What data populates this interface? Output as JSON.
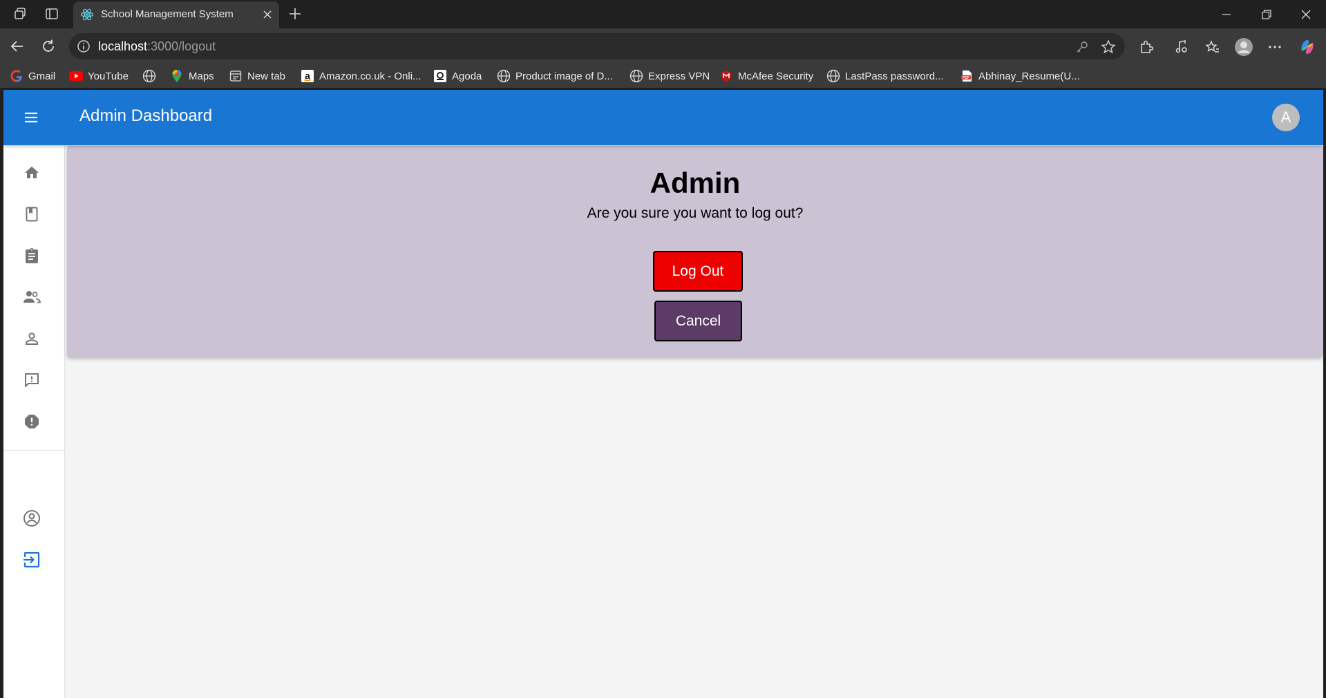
{
  "browser": {
    "tab_title": "School Management System",
    "url_host": "localhost",
    "url_rest": ":3000/logout",
    "bookmarks": [
      {
        "label": "Gmail",
        "icon": "google-icon"
      },
      {
        "label": "YouTube",
        "icon": "youtube-icon"
      },
      {
        "label": "",
        "icon": "globe-icon"
      },
      {
        "label": "Maps",
        "icon": "maps-icon"
      },
      {
        "label": "New tab",
        "icon": "newtab-icon"
      },
      {
        "label": "Amazon.co.uk - Onli...",
        "icon": "amazon-icon"
      },
      {
        "label": "Agoda",
        "icon": "agoda-icon"
      },
      {
        "label": "Product image of D...",
        "icon": "globe-icon"
      },
      {
        "label": "Express VPN",
        "icon": "globe-icon"
      },
      {
        "label": "McAfee Security",
        "icon": "mcafee-icon"
      },
      {
        "label": "LastPass password...",
        "icon": "globe-icon"
      },
      {
        "label": "Abhinay_Resume(U...",
        "icon": "pdf-icon"
      }
    ]
  },
  "app": {
    "title": "Admin Dashboard",
    "avatar_letter": "A",
    "accent_color": "#1976d2",
    "sidebar_icons": [
      "home-icon",
      "class-icon",
      "assignment-icon",
      "teachers-icon",
      "student-icon",
      "notice-icon",
      "complaint-icon",
      "profile-icon",
      "logout-icon"
    ]
  },
  "logout": {
    "heading": "Admin",
    "message": "Are you sure you want to log out?",
    "logout_label": "Log Out",
    "cancel_label": "Cancel",
    "logout_color": "#ee0000",
    "cancel_color": "#5c3b67"
  }
}
